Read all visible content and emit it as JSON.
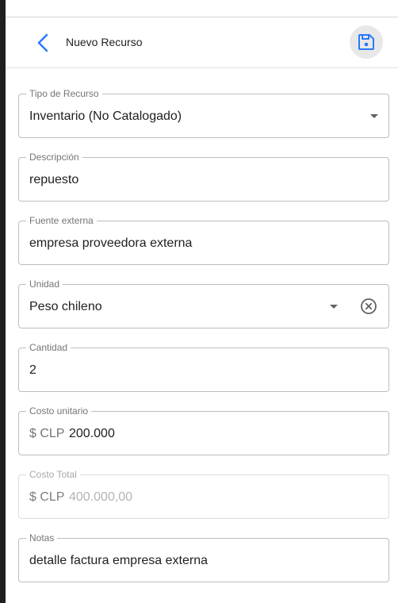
{
  "header": {
    "title": "Nuevo Recurso",
    "back_icon": "chevron-left-icon",
    "save_icon": "floppy-disk-icon",
    "accent_color": "#2979ff"
  },
  "fields": {
    "tipo": {
      "label": "Tipo de Recurso",
      "value": "Inventario (No Catalogado)"
    },
    "descripcion": {
      "label": "Descripción",
      "value": "repuesto"
    },
    "fuente": {
      "label": "Fuente externa",
      "value": "empresa proveedora externa"
    },
    "unidad": {
      "label": "Unidad",
      "value": "Peso chileno"
    },
    "cantidad": {
      "label": "Cantidad",
      "value": "2"
    },
    "costo_unitario": {
      "label": "Costo unitario",
      "prefix": "$ CLP",
      "value": "200.000"
    },
    "costo_total": {
      "label": "Costo Total",
      "prefix": "$ CLP",
      "value": "400.000,00"
    },
    "notas": {
      "label": "Notas",
      "value": "detalle factura empresa externa"
    }
  }
}
